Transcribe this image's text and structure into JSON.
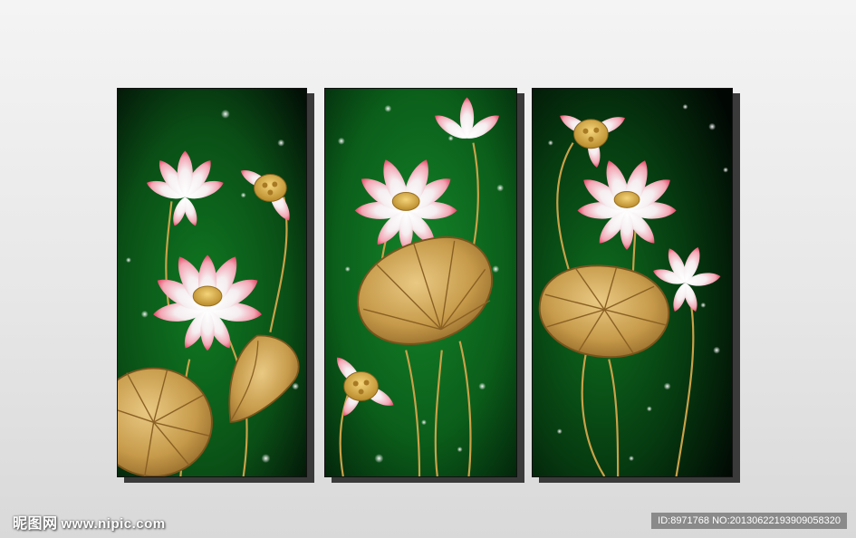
{
  "artwork": {
    "subject": "lotus-triptych",
    "panels": [
      "left-panel",
      "center-panel",
      "right-panel"
    ],
    "colors": {
      "background_green": "#0d6a1c",
      "panel_dark": "#041a08",
      "petal_pink": "#e94f6a",
      "petal_white": "#f4f2f3",
      "gold": "#c9a24a"
    }
  },
  "watermark": {
    "brand": "昵图网",
    "site": "www.nipic.com",
    "id_text": "ID:8971768 NO:20130622193909058320"
  }
}
